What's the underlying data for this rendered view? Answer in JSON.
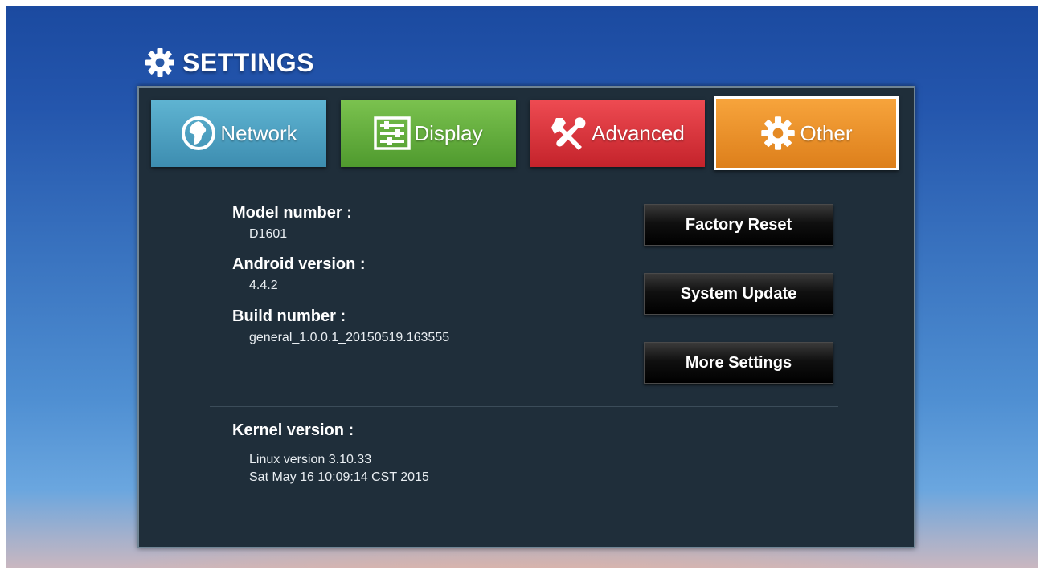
{
  "header": {
    "title": "SETTINGS",
    "icon": "gear-icon"
  },
  "tabs": [
    {
      "label": "Network",
      "icon": "globe-icon",
      "color": "#4aa0c2"
    },
    {
      "label": "Display",
      "icon": "display-sliders-icon",
      "color": "#62ae3c"
    },
    {
      "label": "Advanced",
      "icon": "tools-icon",
      "color": "#dd3139"
    },
    {
      "label": "Other",
      "icon": "gear-icon",
      "color": "#ec9229",
      "selected": true
    }
  ],
  "info": {
    "model_label": "Model number :",
    "model_value": "D1601",
    "android_label": "Android version :",
    "android_value": "4.4.2",
    "build_label": "Build number :",
    "build_value": "general_1.0.0.1_20150519.163555",
    "kernel_label": "Kernel version :",
    "kernel_line1": "Linux version 3.10.33",
    "kernel_line2": "Sat May 16 10:09:14 CST 2015"
  },
  "buttons": {
    "factory_reset": "Factory Reset",
    "system_update": "System Update",
    "more_settings": "More Settings"
  }
}
